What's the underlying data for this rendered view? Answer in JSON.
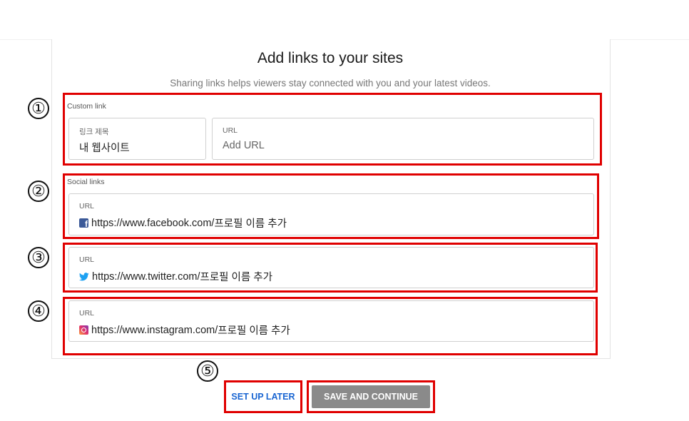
{
  "header": {
    "title": "Add links to your sites",
    "subtitle": "Sharing links helps viewers stay connected with you and your latest videos."
  },
  "custom_link": {
    "section_label": "Custom link",
    "title_field": {
      "label": "링크 제목",
      "value": "내 웹사이트"
    },
    "url_field": {
      "label": "URL",
      "placeholder": "Add URL"
    }
  },
  "social_links": {
    "section_label": "Social links",
    "facebook": {
      "label": "URL",
      "prefix": "https://www.facebook.com/",
      "placeholder": "프로필 이름 추가",
      "icon": "facebook-icon"
    },
    "twitter": {
      "label": "URL",
      "prefix": "https://www.twitter.com/",
      "placeholder": "프로필 이름 추가",
      "icon": "twitter-icon"
    },
    "instagram": {
      "label": "URL",
      "prefix": "https://www.instagram.com/",
      "placeholder": "프로필 이름 추가",
      "icon": "instagram-icon"
    }
  },
  "annotations": {
    "n1": "①",
    "n2": "②",
    "n3": "③",
    "n4": "④",
    "n5": "⑤",
    "highlight_color": "#e00000"
  },
  "actions": {
    "later_label": "SET UP LATER",
    "save_label": "SAVE AND CONTINUE"
  },
  "colors": {
    "link_blue": "#1a66d2",
    "save_button_bg": "#8a8a8a",
    "facebook": "#3b5998",
    "twitter": "#1da1f2"
  }
}
